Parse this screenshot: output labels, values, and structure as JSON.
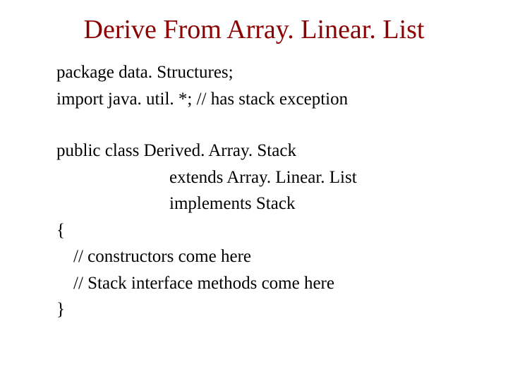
{
  "title": "Derive From Array. Linear. List",
  "code": {
    "line1": "package data. Structures;",
    "line2": "import java. util. *;  // has stack exception",
    "line3": "public class Derived. Array. Stack",
    "line4": "extends Array. Linear. List",
    "line5": "implements Stack",
    "line6": "{",
    "line7": "// constructors come here",
    "line8": "// Stack interface methods come here",
    "line9": "}"
  }
}
